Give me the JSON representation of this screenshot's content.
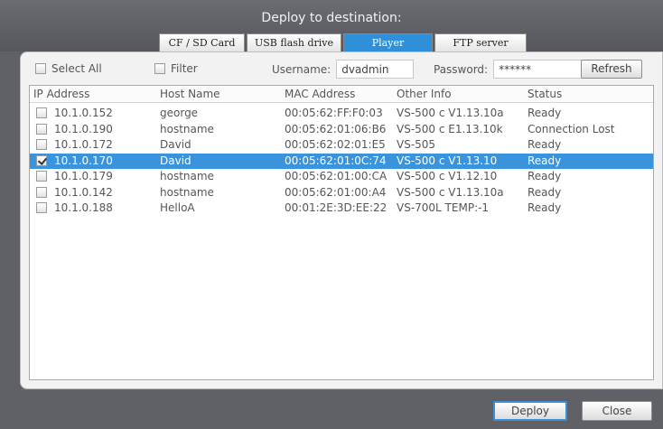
{
  "dialog": {
    "title": "Deploy to destination:"
  },
  "tabs": [
    {
      "label": "CF / SD Card"
    },
    {
      "label": "USB flash drive"
    },
    {
      "label": "Player",
      "active": true
    },
    {
      "label": "FTP server"
    }
  ],
  "toolbar": {
    "select_all_label": "Select All",
    "filter_label": "Filter",
    "username_label": "Username:",
    "username_value": "dvadmin",
    "password_label": "Password:",
    "password_value": "******",
    "refresh_label": "Refresh"
  },
  "table": {
    "columns": [
      "IP Address",
      "Host Name",
      "MAC Address",
      "Other Info",
      "Status"
    ],
    "rows": [
      {
        "ip": "10.1.0.152",
        "host": "george",
        "mac": "00:05:62:FF:F0:03",
        "info": "VS-500 c V1.13.10a",
        "status": "Ready",
        "checked": false,
        "selected": false
      },
      {
        "ip": "10.1.0.190",
        "host": "hostname",
        "mac": "00:05:62:01:06:B6",
        "info": "VS-500 c E1.13.10k",
        "status": "Connection Lost",
        "checked": false,
        "selected": false
      },
      {
        "ip": "10.1.0.172",
        "host": "David",
        "mac": "00:05:62:02:01:E5",
        "info": "VS-505",
        "status": "Ready",
        "checked": false,
        "selected": false
      },
      {
        "ip": "10.1.0.170",
        "host": "David",
        "mac": "00:05:62:01:0C:74",
        "info": "VS-500 c V1.13.10",
        "status": "Ready",
        "checked": true,
        "selected": true
      },
      {
        "ip": "10.1.0.179",
        "host": "hostname",
        "mac": "00:05:62:01:00:CA",
        "info": "VS-500 c V1.12.10",
        "status": "Ready",
        "checked": false,
        "selected": false
      },
      {
        "ip": "10.1.0.142",
        "host": "hostname",
        "mac": "00:05:62:01:00:A4",
        "info": "VS-500 c V1.13.10a",
        "status": "Ready",
        "checked": false,
        "selected": false
      },
      {
        "ip": "10.1.0.188",
        "host": "HelloA",
        "mac": "00:01:2E:3D:EE:22",
        "info": "VS-700L TEMP:-1",
        "status": "Ready",
        "checked": false,
        "selected": false
      }
    ]
  },
  "footer": {
    "deploy_label": "Deploy",
    "close_label": "Close"
  },
  "colors": {
    "selection": "#3a93dd",
    "active_tab": "#2f8fd8",
    "dialog_bg": "#5f6166"
  }
}
